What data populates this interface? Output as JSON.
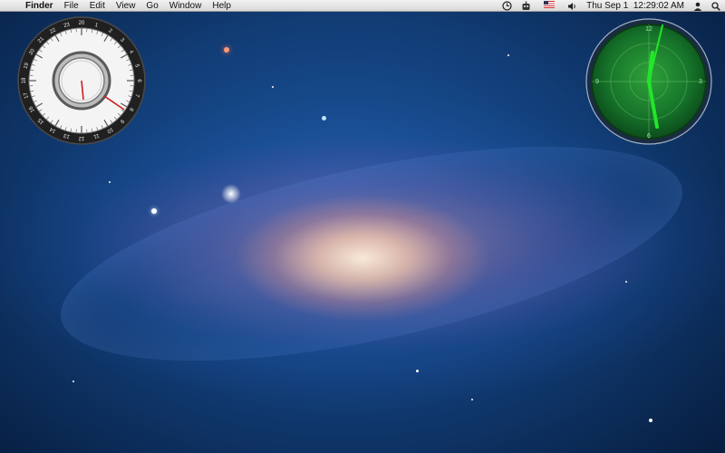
{
  "menubar": {
    "apple": "",
    "app_name": "Finder",
    "menus": [
      "File",
      "Edit",
      "View",
      "Go",
      "Window",
      "Help"
    ],
    "status": {
      "time_machine_icon": "clock-icon",
      "user_icon": "robot-icon",
      "input_source": "us-flag-icon",
      "volume_icon": "speaker-icon",
      "datetime": "Thu Sep 1  12:29:02 AM",
      "user_menu_icon": "user-silhouette-icon",
      "spotlight_icon": "search-icon"
    }
  },
  "widgets": {
    "combo_clock": {
      "outer_ring": [
        "20",
        "1",
        "2",
        "3",
        "4",
        "5",
        "6",
        "7",
        "8",
        "9",
        "10",
        "11",
        "12",
        "13",
        "14",
        "15",
        "16",
        "17",
        "18",
        "19",
        "20",
        "21",
        "22",
        "23"
      ],
      "hands": {
        "hour": 12,
        "minute": 29
      }
    },
    "radar_clock": {
      "labels": [
        "12",
        "3",
        "6",
        "9"
      ],
      "hands": {
        "hour": 12,
        "minute": 29,
        "second": 2
      }
    }
  },
  "colors": {
    "radar_green": "#1fdc2a",
    "accent_red": "#d01f1f"
  }
}
